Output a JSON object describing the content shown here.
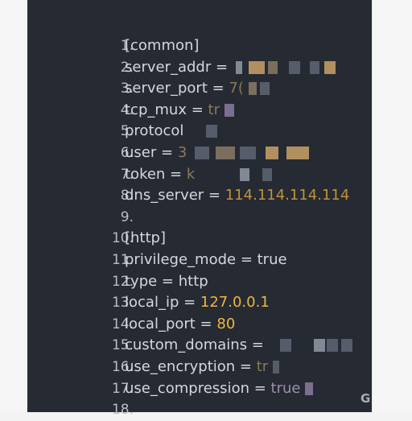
{
  "code": {
    "lines": [
      {
        "n": "1.",
        "text": "[common]"
      },
      {
        "n": "2.",
        "text": "server_addr ="
      },
      {
        "n": "3.",
        "text": "server_port =",
        "visible_value": "7("
      },
      {
        "n": "4.",
        "text": "tcp_mux =",
        "visible_value": "tr"
      },
      {
        "n": "5.",
        "text": "protocol"
      },
      {
        "n": "6.",
        "text": "user =",
        "visible_value": "3"
      },
      {
        "n": "7.",
        "text": "token =",
        "visible_value": "k"
      },
      {
        "n": "8.",
        "text": "dns_server =",
        "visible_value": "114.114.114.114"
      },
      {
        "n": "9.",
        "text": ""
      },
      {
        "n": "10.",
        "text": "[http]"
      },
      {
        "n": "11.",
        "text": "privilege_mode = true"
      },
      {
        "n": "12.",
        "text": "type = http"
      },
      {
        "n": "13.",
        "text": "local_ip =",
        "value": "127.0.0.1"
      },
      {
        "n": "14.",
        "text": "local_port =",
        "value": "80"
      },
      {
        "n": "15.",
        "text": "custom_domains ="
      },
      {
        "n": "16.",
        "text": "use_encryption =",
        "visible_value": "tr"
      },
      {
        "n": "17.",
        "text": "use_compression =",
        "visible_value": "true"
      },
      {
        "n": "18.",
        "text": ""
      }
    ]
  },
  "colors": {
    "panel_bg": "#262a33",
    "text": "#d6d7dc",
    "line_number": "#b9bcc4",
    "value_accent": "#f0b73a"
  },
  "watermark": "G"
}
